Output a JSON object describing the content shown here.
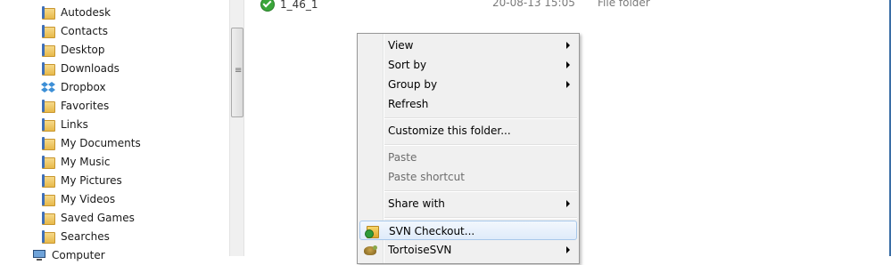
{
  "nav": {
    "items": [
      {
        "label": "Autodesk",
        "icon": "folder-icon"
      },
      {
        "label": "Contacts",
        "icon": "contacts-folder-icon"
      },
      {
        "label": "Desktop",
        "icon": "desktop-folder-icon"
      },
      {
        "label": "Downloads",
        "icon": "downloads-folder-icon"
      },
      {
        "label": "Dropbox",
        "icon": "dropbox-icon"
      },
      {
        "label": "Favorites",
        "icon": "favorites-folder-icon"
      },
      {
        "label": "Links",
        "icon": "links-folder-icon"
      },
      {
        "label": "My Documents",
        "icon": "documents-folder-icon"
      },
      {
        "label": "My Music",
        "icon": "music-folder-icon"
      },
      {
        "label": "My Pictures",
        "icon": "pictures-folder-icon"
      },
      {
        "label": "My Videos",
        "icon": "videos-folder-icon"
      },
      {
        "label": "Saved Games",
        "icon": "saved-games-folder-icon"
      },
      {
        "label": "Searches",
        "icon": "searches-folder-icon"
      },
      {
        "label": "Computer",
        "icon": "computer-icon"
      }
    ]
  },
  "files": {
    "rows": [
      {
        "name": "1_46_1",
        "date": "20-08-13 15:05",
        "type": "File folder",
        "icon": "svn-normal-overlay-icon"
      }
    ]
  },
  "context_menu": {
    "items": [
      {
        "label": "View",
        "submenu": true,
        "disabled": false
      },
      {
        "label": "Sort by",
        "submenu": true,
        "disabled": false
      },
      {
        "label": "Group by",
        "submenu": true,
        "disabled": false
      },
      {
        "label": "Refresh",
        "submenu": false,
        "disabled": false
      },
      {
        "label": "Customize this folder...",
        "submenu": false,
        "disabled": false
      },
      {
        "label": "Paste",
        "submenu": false,
        "disabled": true
      },
      {
        "label": "Paste shortcut",
        "submenu": false,
        "disabled": true
      },
      {
        "label": "Share with",
        "submenu": true,
        "disabled": false
      },
      {
        "label": "SVN Checkout...",
        "submenu": false,
        "disabled": false,
        "highlighted": true,
        "icon": "svn-checkout-icon"
      },
      {
        "label": "TortoiseSVN",
        "submenu": true,
        "disabled": false,
        "icon": "tortoisesvn-icon"
      }
    ]
  },
  "colors": {
    "menu_background": "#f0f0f0",
    "highlight_border": "#a8c8ea",
    "window_border": "#3b6ea5"
  }
}
